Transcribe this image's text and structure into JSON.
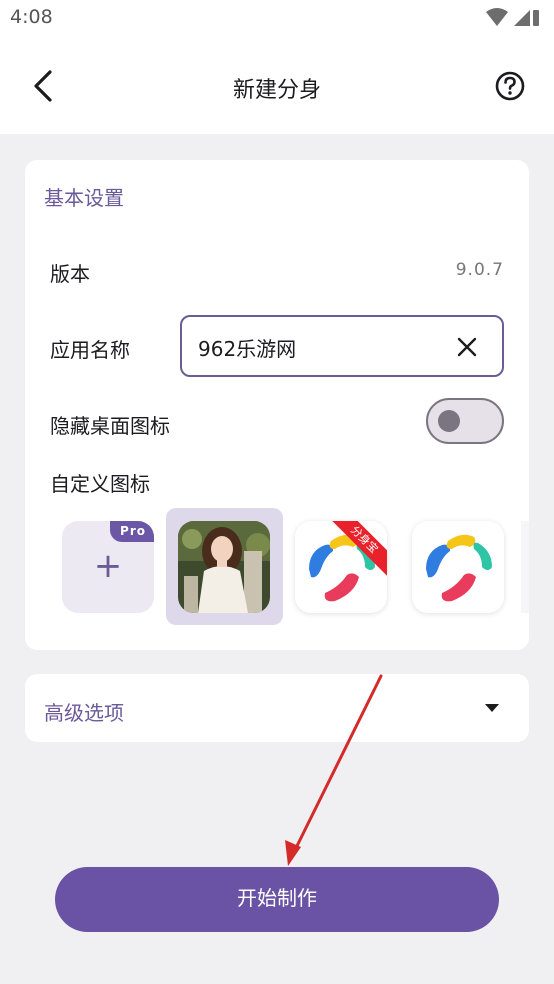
{
  "status_bar": {
    "time": "4:08"
  },
  "header": {
    "title": "新建分身"
  },
  "basic": {
    "section_title": "基本设置",
    "version_label": "版本",
    "version_value": "9.0.7",
    "app_name_label": "应用名称",
    "app_name_value": "962乐游网",
    "hide_icon_label": "隐藏桌面图标",
    "hide_icon_enabled": false,
    "custom_icon_label": "自定义图标",
    "pro_badge": "Pro",
    "add_icon_symbol": "+",
    "ribbon_text": "分身宝"
  },
  "advanced": {
    "label": "高级选项"
  },
  "actions": {
    "start_label": "开始制作"
  },
  "colors": {
    "accent": "#6a52a4",
    "section_title": "#6a5a9a",
    "background": "#f0eff2",
    "annotation_arrow": "#d42a2a"
  }
}
